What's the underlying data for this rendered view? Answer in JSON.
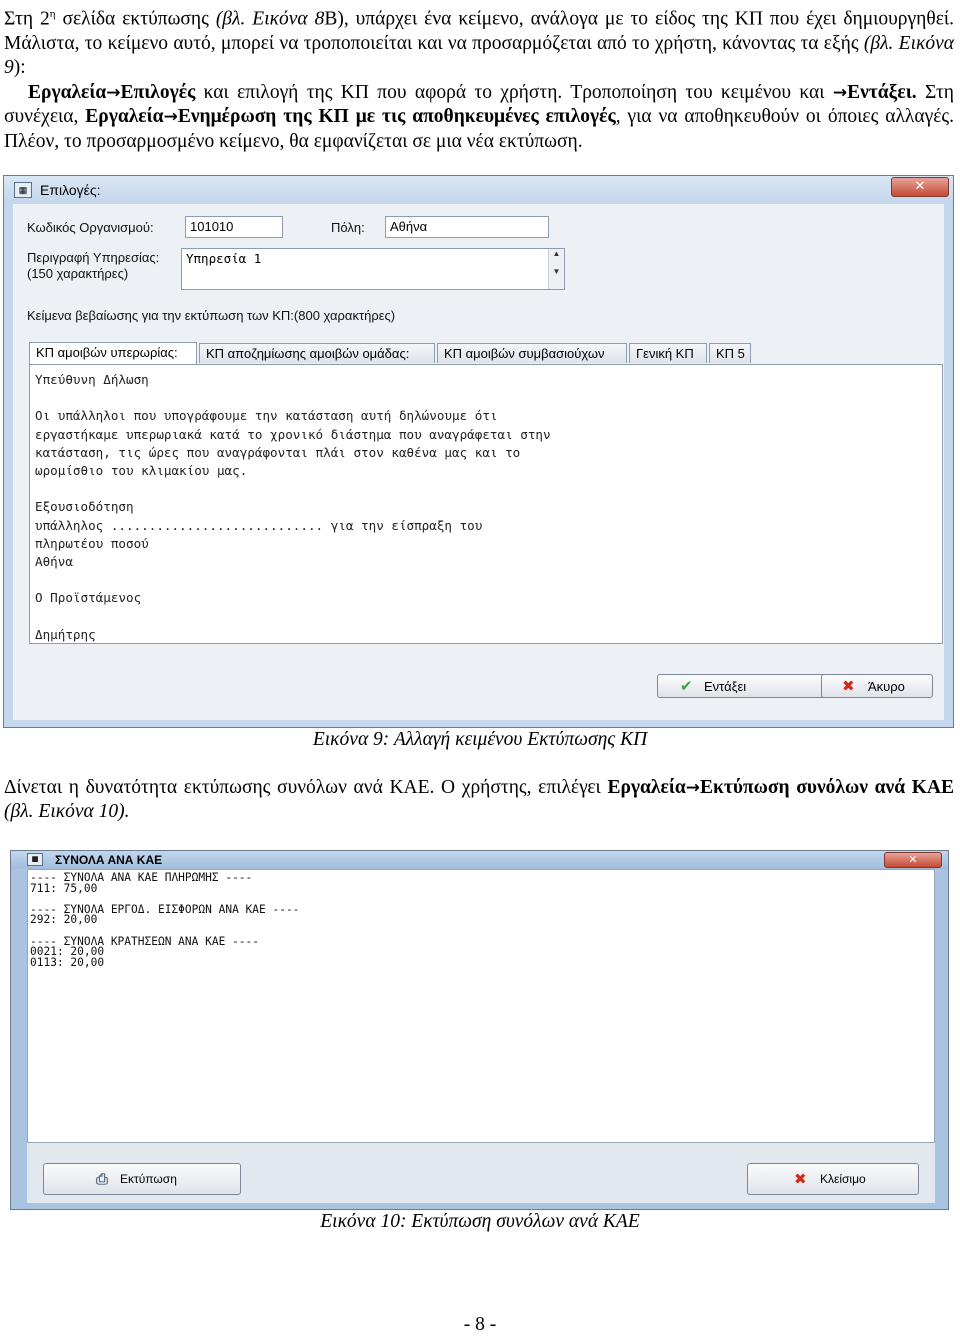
{
  "intro": {
    "p1_a": "Στη 2",
    "p1_sup": "η",
    "p1_b": " σελίδα εκτύπωσης ",
    "p1_ref": "(βλ. Εικόνα 8",
    "p1_c": "Β), υπάρχει ένα κείμενο, ανάλογα με το είδος της ΚΠ που έχει δημιουργηθεί. Μάλιστα, το κείμενο αυτό, μπορεί να τροποποιείται και να προσαρμόζεται από το χρήστη, κάνοντας τα εξής ",
    "p1_ref2": "(βλ. Εικόνα 9",
    "p1_d": "):",
    "menu1": "Εργαλεία",
    "arrow": "→",
    "menu1b": "Επιλογές",
    "p1_e": " και επιλογή της ΚΠ που αφορά το χρήστη. Τροποποίηση του κειμένου και ",
    "ok": "Εντάξει.",
    "p1_f": " Στη συνέχεια, ",
    "menu2": "Εργαλεία",
    "menu2b": "Ενημέρωση της ΚΠ με τις αποθηκευμένες επιλογές",
    "p1_g": ", για να αποθηκευθούν οι όποιες αλλαγές. Πλέον, το προσαρμοσμένο κείμενο, θα εμφανίζεται σε μια νέα εκτύπωση."
  },
  "window1": {
    "title": "Επιλογές:",
    "close": "✕",
    "org_code_label": "Κωδικός Οργανισμού:",
    "org_code_value": "101010",
    "city_label": "Πόλη:",
    "city_value": "Αθήνα",
    "service_label_1": "Περιγραφή Υπηρεσίας:",
    "service_label_2": "(150 χαρακτήρες)",
    "service_value": "Υπηρεσία 1",
    "certify_label": "Κείμενα βεβαίωσης για την εκτύπωση των ΚΠ:(800 χαρακτήρες)",
    "tabs": [
      "ΚΠ αμοιβών υπερωρίας:",
      "ΚΠ αποζημίωσης αμοιβών ομάδας:",
      "ΚΠ αμοιβών συμβασιούχων",
      "Γενική ΚΠ",
      "ΚΠ 5"
    ],
    "text_lines": [
      "Υπεύθυνη Δήλωση",
      "",
      "Οι υπάλληλοι που υπογράφουμε την κατάσταση αυτή δηλώνουμε ότι",
      "εργαστήκαμε υπερωριακά κατά το χρονικό διάστημα που αναγράφεται στην",
      "κατάσταση, τις ώρες που αναγράφονται πλάι στον καθένα μας και το",
      "ωρομίσθιο του κλιμακίου μας.",
      "",
      "Εξουσιοδότηση",
      "υπάλληλος ............................ για την είσπραξη του",
      "πληρωτέου ποσού",
      "Αθήνα",
      "",
      "Ο Προϊστάμενος",
      "",
      "Δημήτρης"
    ],
    "ok_button": "Εντάξει",
    "cancel_button": "Άκυρο"
  },
  "caption9": "Εικόνα 9: Αλλαγή κειμένου Εκτύπωσης ΚΠ",
  "para2": {
    "a": "Δίνεται η δυνατότητα εκτύπωσης συνόλων ανά ΚΑΕ. Ο χρήστης, επιλέγει ",
    "menu": "Εργαλεία",
    "arrow": "→",
    "menub": "Εκτύπωση συνόλων ανά ΚΑΕ",
    "ref": " (βλ. Εικόνα 10)."
  },
  "window2": {
    "title": "ΣΥΝΟΛΑ ΑΝΑ ΚΑΕ",
    "close": "✕",
    "report_lines": [
      "---- ΣΥΝΟΛΑ ΑΝΑ ΚΑΕ ΠΛΗΡΩΜΗΣ ----",
      "711: 75,00",
      "",
      "---- ΣΥΝΟΛΑ ΕΡΓΟΔ. ΕΙΣΦΟΡΩΝ ΑΝΑ ΚΑΕ ----",
      "292: 20,00",
      "",
      "---- ΣΥΝΟΛΑ ΚΡΑΤΗΣΕΩΝ ΑΝΑ ΚΑΕ ----",
      "0021: 20,00",
      "0113: 20,00"
    ],
    "print_button": "Εκτύπωση",
    "close_button": "Κλείσιμο"
  },
  "caption10": "Εικόνα 10: Εκτύπωση συνόλων ανά ΚΑΕ",
  "page_number": "- 8 -"
}
